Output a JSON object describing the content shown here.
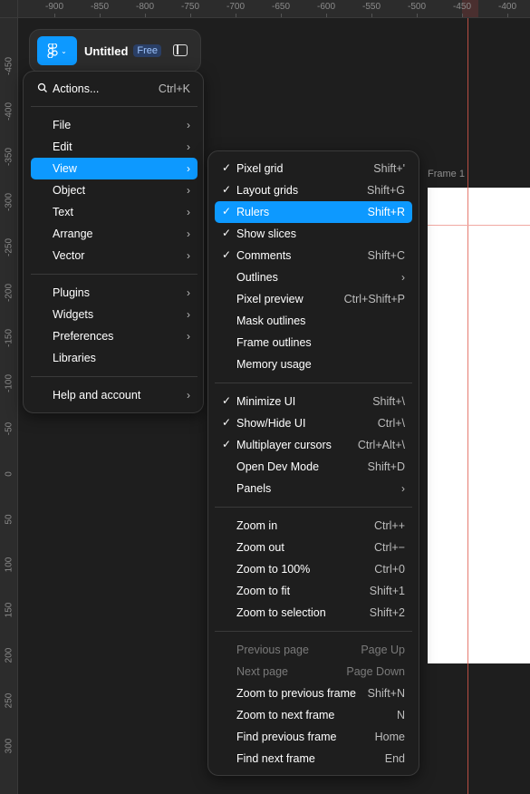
{
  "rulers": {
    "top_labels": [
      "-900",
      "-850",
      "-800",
      "-750",
      "-700",
      "-650",
      "-600",
      "-550",
      "-500",
      "-450",
      "-400"
    ],
    "left_labels": [
      "-450",
      "-400",
      "-350",
      "-300",
      "-250",
      "-200",
      "-150",
      "-100",
      "-50",
      "0",
      "50",
      "100",
      "150",
      "200",
      "250",
      "300"
    ]
  },
  "canvas": {
    "frame_label": "Frame 1"
  },
  "toolbar": {
    "title": "Untitled",
    "plan_badge": "Free",
    "logo_icon": "figma-logo-icon",
    "panel_icon": "sidebar-toggle-icon"
  },
  "main_menu": {
    "search": {
      "label": "Actions...",
      "shortcut": "Ctrl+K"
    },
    "items": [
      {
        "label": "File",
        "submenu": true
      },
      {
        "label": "Edit",
        "submenu": true
      },
      {
        "label": "View",
        "submenu": true,
        "active": true
      },
      {
        "label": "Object",
        "submenu": true
      },
      {
        "label": "Text",
        "submenu": true
      },
      {
        "label": "Arrange",
        "submenu": true
      },
      {
        "label": "Vector",
        "submenu": true
      },
      {
        "label": "Plugins",
        "submenu": true
      },
      {
        "label": "Widgets",
        "submenu": true
      },
      {
        "label": "Preferences",
        "submenu": true
      },
      {
        "label": "Libraries",
        "submenu": false
      },
      {
        "label": "Help and account",
        "submenu": true
      }
    ]
  },
  "view_menu": {
    "items": [
      {
        "label": "Pixel grid",
        "shortcut": "Shift+'",
        "checked": true
      },
      {
        "label": "Layout grids",
        "shortcut": "Shift+G",
        "checked": true
      },
      {
        "label": "Rulers",
        "shortcut": "Shift+R",
        "checked": true,
        "active": true
      },
      {
        "label": "Show slices",
        "shortcut": "",
        "checked": true
      },
      {
        "label": "Comments",
        "shortcut": "Shift+C",
        "checked": true
      },
      {
        "label": "Outlines",
        "shortcut": "",
        "submenu": true
      },
      {
        "label": "Pixel preview",
        "shortcut": "Ctrl+Shift+P"
      },
      {
        "label": "Mask outlines",
        "shortcut": ""
      },
      {
        "label": "Frame outlines",
        "shortcut": ""
      },
      {
        "label": "Memory usage",
        "shortcut": ""
      },
      {
        "label": "Minimize UI",
        "shortcut": "Shift+\\",
        "checked": true
      },
      {
        "label": "Show/Hide UI",
        "shortcut": "Ctrl+\\",
        "checked": true
      },
      {
        "label": "Multiplayer cursors",
        "shortcut": "Ctrl+Alt+\\",
        "checked": true
      },
      {
        "label": "Open Dev Mode",
        "shortcut": "Shift+D"
      },
      {
        "label": "Panels",
        "shortcut": "",
        "submenu": true
      },
      {
        "label": "Zoom in",
        "shortcut": "Ctrl++"
      },
      {
        "label": "Zoom out",
        "shortcut": "Ctrl+−"
      },
      {
        "label": "Zoom to 100%",
        "shortcut": "Ctrl+0"
      },
      {
        "label": "Zoom to fit",
        "shortcut": "Shift+1"
      },
      {
        "label": "Zoom to selection",
        "shortcut": "Shift+2"
      },
      {
        "label": "Previous page",
        "shortcut": "Page Up",
        "disabled": true
      },
      {
        "label": "Next page",
        "shortcut": "Page Down",
        "disabled": true
      },
      {
        "label": "Zoom to previous frame",
        "shortcut": "Shift+N"
      },
      {
        "label": "Zoom to next frame",
        "shortcut": "N"
      },
      {
        "label": "Find previous frame",
        "shortcut": "Home"
      },
      {
        "label": "Find next frame",
        "shortcut": "End"
      }
    ]
  },
  "colors": {
    "accent": "#0d99ff",
    "menu_bg": "#1e1e1e",
    "guide": "#e05a4e"
  }
}
